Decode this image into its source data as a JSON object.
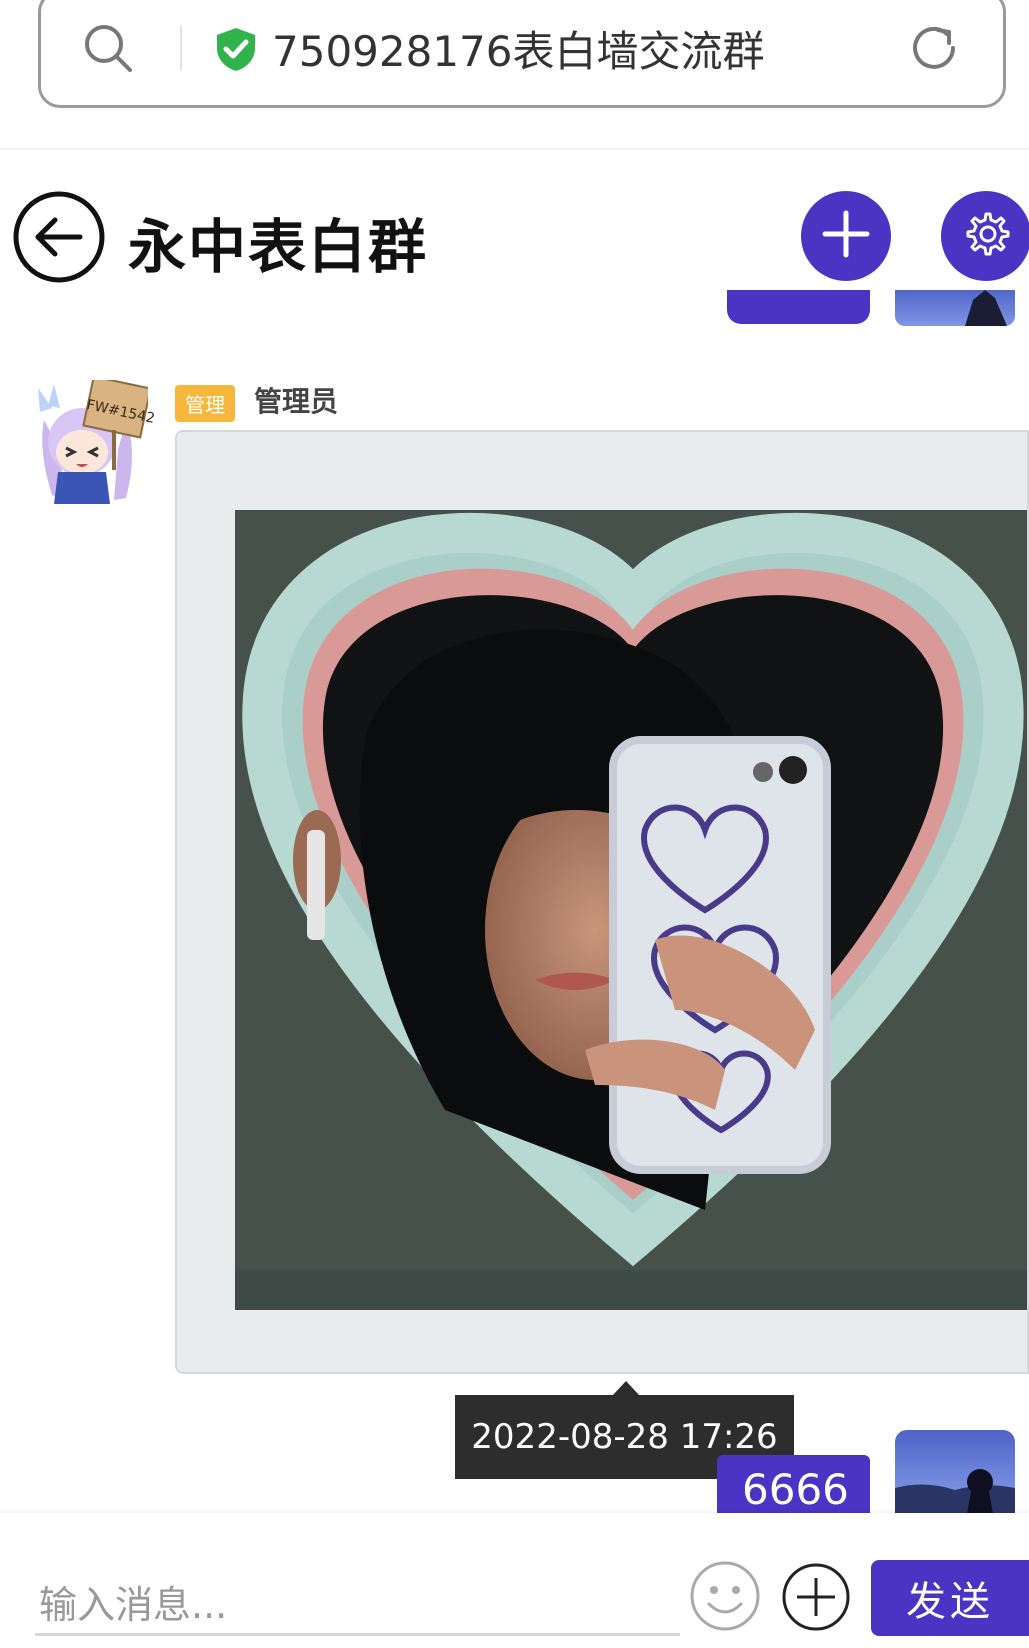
{
  "browser": {
    "url_text": "750928176表白墙交流群"
  },
  "header": {
    "title": "永中表白群"
  },
  "message": {
    "badge": "管理",
    "sender": "管理员",
    "avatar_sign_text": "FW#1542"
  },
  "tooltip": {
    "timestamp": "2022-08-28 17:26"
  },
  "my_message": {
    "text": "6666"
  },
  "composer": {
    "placeholder": "输入消息...",
    "send_label": "发送"
  },
  "colors": {
    "accent": "#4b34c4",
    "badge": "#f6b73c",
    "secure": "#2fb34a"
  }
}
